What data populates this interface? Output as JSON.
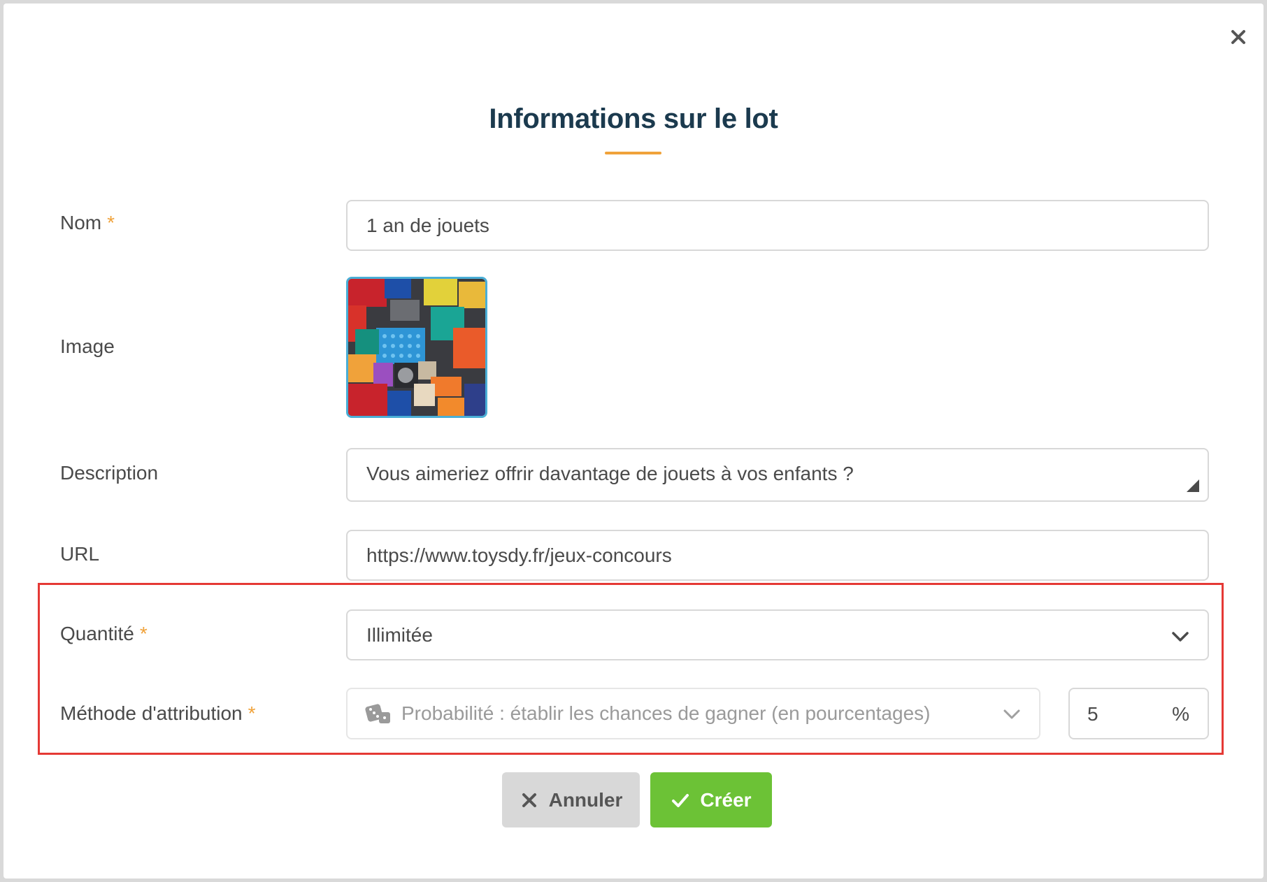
{
  "modal": {
    "title": "Informations sur le lot",
    "close_icon": "close-icon",
    "accent_color": "#f0a23a"
  },
  "form": {
    "nom": {
      "label": "Nom",
      "required": "*",
      "value": "1 an de jouets"
    },
    "image": {
      "label": "Image",
      "thumbnail_icon": "toy-bricks-thumbnail"
    },
    "description": {
      "label": "Description",
      "value": "Vous aimeriez offrir davantage de jouets à vos enfants ?"
    },
    "url": {
      "label": "URL",
      "value": "https://www.toysdy.fr/jeux-concours"
    },
    "quantite": {
      "label": "Quantité",
      "required": "*",
      "selected": "Illimitée"
    },
    "methode": {
      "label": "Méthode d'attribution",
      "required": "*",
      "selected": "Probabilité : établir les chances de gagner (en pourcentages)",
      "icon": "dice-icon",
      "percentage_value": "5",
      "percentage_unit": "%"
    }
  },
  "actions": {
    "cancel_label": "Annuler",
    "create_label": "Créer",
    "cancel_color": "#d8d8d8",
    "create_color": "#6cc236"
  },
  "highlight_color": "#e53935"
}
